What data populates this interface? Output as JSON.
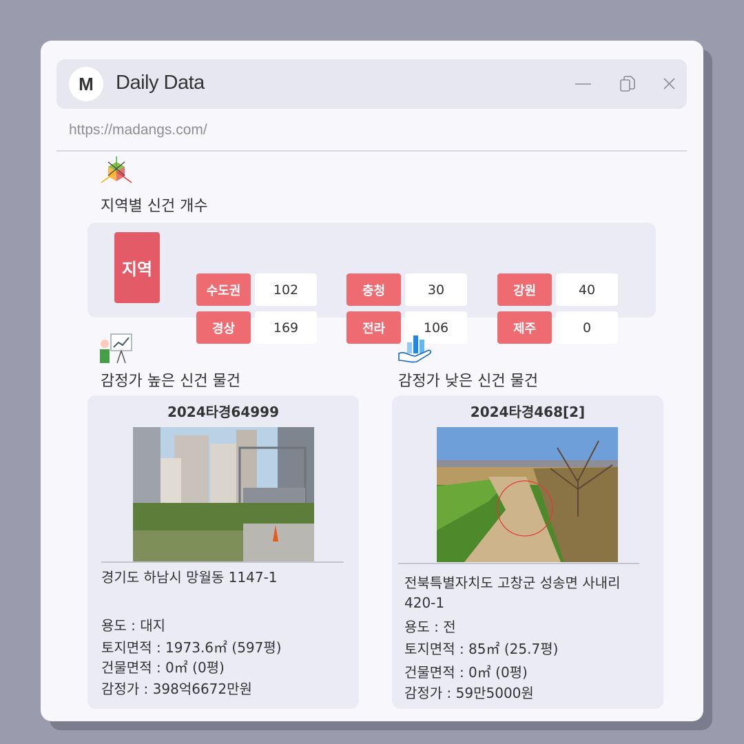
{
  "window": {
    "logo_letter": "M",
    "app_title": "Daily Data",
    "url": "https://madangs.com/"
  },
  "regions": {
    "title": "지역별 신건 개수",
    "main_label": "지역",
    "items": [
      {
        "name": "수도권",
        "count": "102"
      },
      {
        "name": "충청",
        "count": "30"
      },
      {
        "name": "강원",
        "count": "40"
      },
      {
        "name": "경상",
        "count": "169"
      },
      {
        "name": "전라",
        "count": "106"
      },
      {
        "name": "제주",
        "count": "0"
      }
    ]
  },
  "high": {
    "title": "감정가 높은 신건 물건",
    "case_no": "2024타경64999",
    "address": "경기도 하남시 망월동 1147-1",
    "usage": "용도 : 대지",
    "land_area": "토지면적 : 1973.6㎡ (597평)",
    "building_area": "건물면적 : 0㎡ (0평)",
    "appraisal": "감정가 : 398억6672만원"
  },
  "low": {
    "title": "감정가 낮은 신건 물건",
    "case_no": "2024타경468[2]",
    "address_line1": "전북특별자치도 고창군 성송면 사내리",
    "address_line2": "420-1",
    "usage": "용도 : 전",
    "land_area": "토지면적 : 85㎡ (25.7평)",
    "building_area": "건물면적 : 0㎡ (0평)",
    "appraisal": "감정가 : 59만5000원"
  },
  "colors": {
    "background": "#9a9bac",
    "window": "#f7f7fc",
    "panel": "#eaebf5",
    "region_label": "#ef6b72",
    "region_main": "#e35b66"
  },
  "icons": {
    "window_controls": [
      "minimize-icon",
      "copy-icon",
      "close-icon"
    ],
    "sections": [
      "cube-axes-icon",
      "presentation-chart-icon",
      "hand-bar-chart-icon"
    ]
  }
}
